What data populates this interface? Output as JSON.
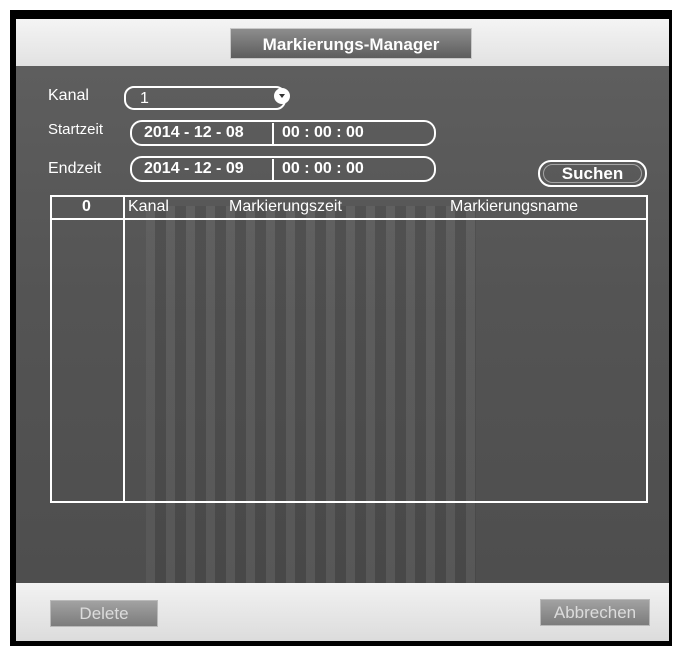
{
  "dialog": {
    "title": "Markierungs-Manager"
  },
  "filters": {
    "kanal_label": "Kanal",
    "kanal_value": "1",
    "startzeit_label": "Startzeit",
    "startzeit_date": "2014 - 12 - 08",
    "startzeit_time": "00 : 00 : 00",
    "endzeit_label": "Endzeit",
    "endzeit_date": "2014 - 12 - 09",
    "endzeit_time": "00 : 00 : 00",
    "search_label": "Suchen"
  },
  "table": {
    "columns": [
      "0",
      "Kanal",
      "Markierungszeit",
      "Markierungsname"
    ],
    "rows": []
  },
  "footer": {
    "delete_label": "Delete",
    "cancel_label": "Abbrechen"
  },
  "icons": {
    "select_arrow": "chevron-down-icon"
  }
}
